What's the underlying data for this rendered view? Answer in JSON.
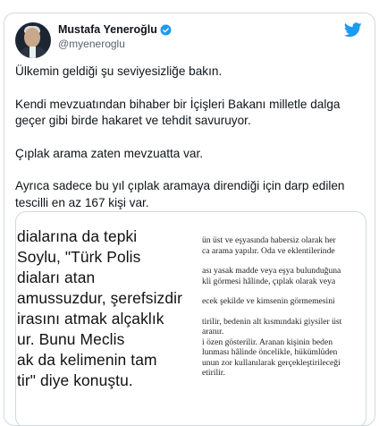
{
  "author": {
    "display_name": "Mustafa Yeneroğlu",
    "handle": "@myeneroglu"
  },
  "tweet": {
    "paragraphs": [
      "Ülkemin geldiği şu seviyesizliğe bakın.",
      "Kendi mevzuatından bihaber bir İçişleri Bakanı milletle dalga geçer gibi birde hakaret ve tehdit savuruyor.",
      "Çıplak arama zaten mevzuatta var.",
      "Ayrıca sadece bu yıl çıplak aramaya direndiği için darp edilen tescilli en az 167 kişi var."
    ]
  },
  "media": {
    "left_lines": [
      "dialarına da tepki",
      "Soylu, \"Türk Polis",
      "diaları atan",
      "amussuzdur, şerefsizdir",
      "irasını atmak alçaklık",
      "ur. Bunu Meclis",
      "ak da kelimenin tam",
      "tir\" diye konuştu."
    ],
    "right_lines": [
      "ün üst ve eşyasında habersiz olarak her",
      "ca arama yapılır. Oda ve eklentilerinde",
      "",
      "ası yasak madde veya eşya bulunduğuna",
      "kli görmesi hâlinde, çıplak olarak veya",
      "",
      "ecek şekilde ve kimsenin görmemesini",
      "",
      "tirilir, bedenin alt kısmındaki giysiler üst",
      "aranır.",
      "i özen gösterilir. Aranan kişinin beden",
      "lunması hâlinde öncelikle, hükümlüden",
      "unun zor kullanılarak gerçekleştirileceği",
      "etirilir."
    ]
  },
  "colors": {
    "text": "#0f1419",
    "secondary": "#536471",
    "twitter_blue": "#1d9bf0",
    "border": "#cfd9de"
  },
  "icons": {
    "verified": "verified-badge-icon",
    "bird": "twitter-bird-icon"
  }
}
